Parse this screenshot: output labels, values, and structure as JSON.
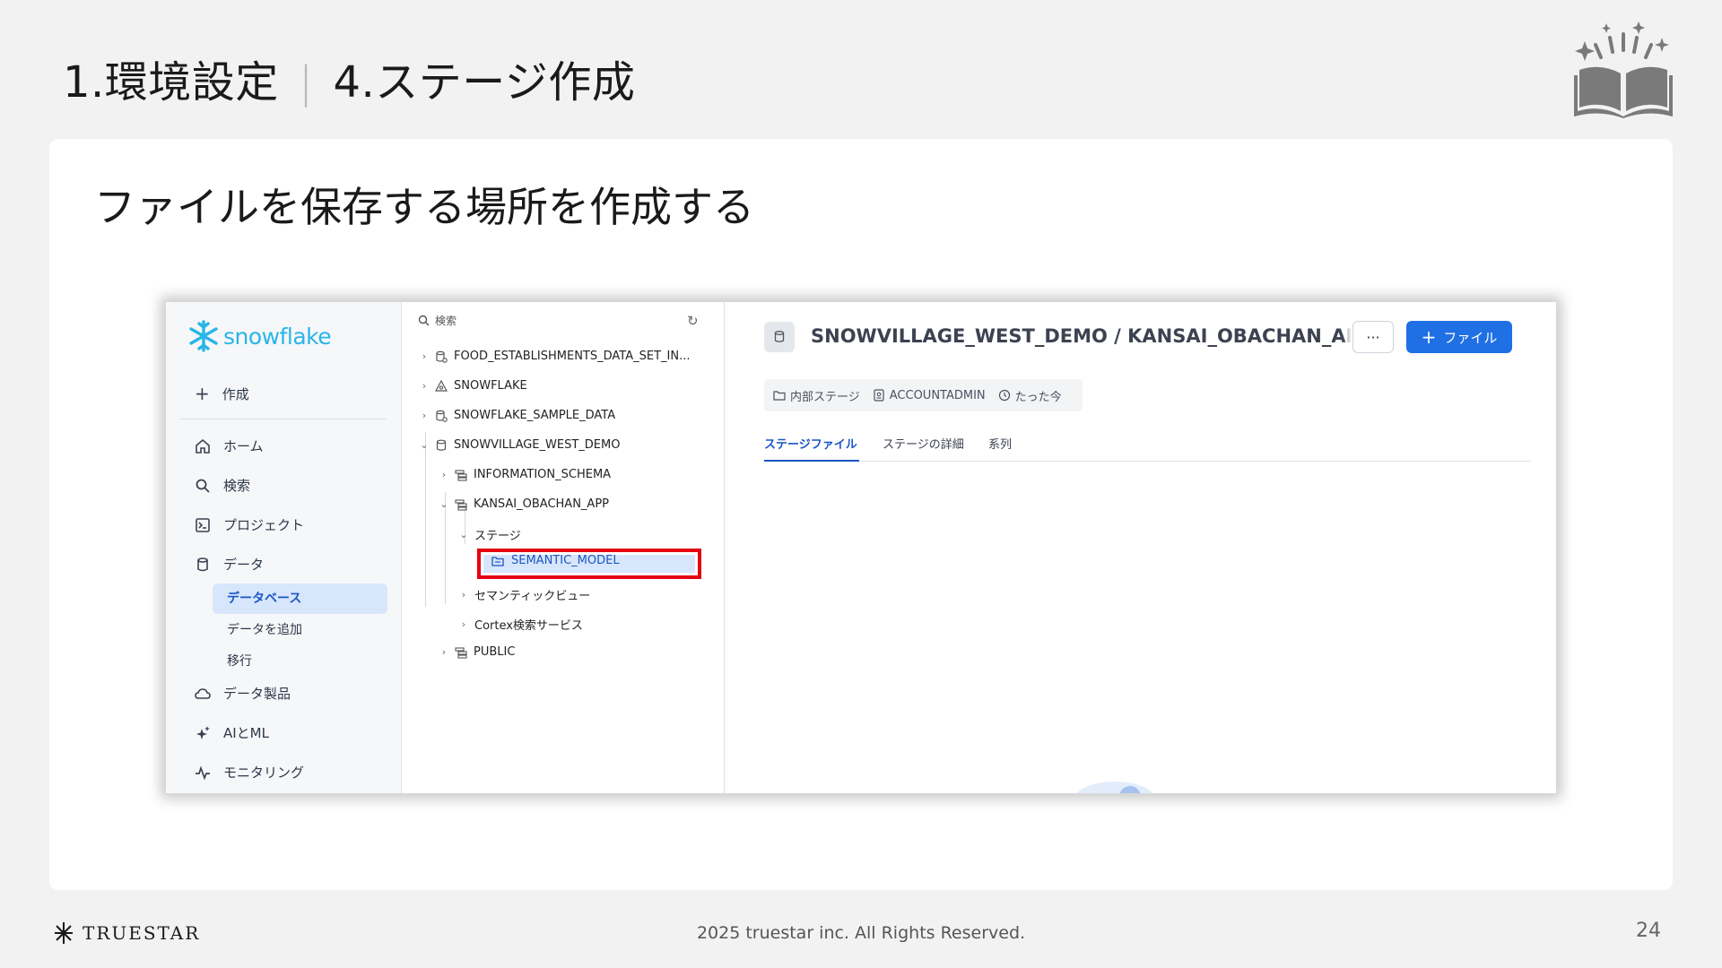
{
  "header": {
    "section_title": "1.環境設定",
    "separator": "|",
    "step_title": "4.ステージ作成"
  },
  "subtitle": "ファイルを保存する場所を作成する",
  "snowflake": {
    "logo_text": "snowflake",
    "nav": {
      "create_label": "作成",
      "items": [
        {
          "label": "ホーム",
          "icon": "home-icon"
        },
        {
          "label": "検索",
          "icon": "search-icon"
        },
        {
          "label": "プロジェクト",
          "icon": "terminal-icon"
        },
        {
          "label": "データ",
          "icon": "database-icon"
        },
        {
          "label": "データ製品",
          "icon": "cloud-icon"
        },
        {
          "label": "AIとML",
          "icon": "sparkle-icon"
        },
        {
          "label": "モニタリング",
          "icon": "activity-icon"
        }
      ],
      "data_sub_items": [
        {
          "label": "データベース",
          "active": true
        },
        {
          "label": "データを追加",
          "active": false
        },
        {
          "label": "移行",
          "active": false
        }
      ]
    },
    "tree": {
      "search_placeholder": "検索",
      "rows": [
        "FOOD_ESTABLISHMENTS_DATA_SET_IN...",
        "SNOWFLAKE",
        "SNOWFLAKE_SAMPLE_DATA",
        "SNOWVILLAGE_WEST_DEMO",
        "INFORMATION_SCHEMA",
        "KANSAI_OBACHAN_APP",
        "ステージ",
        "SEMANTIC_MODEL",
        "セマンティックビュー",
        "Cortex検索サービス",
        "PUBLIC"
      ],
      "highlight_color": "#e60012"
    },
    "main": {
      "path_title": "SNOWVILLAGE_WEST_DEMO / KANSAI_OBACHAN_APP / SEMANTIC_MODEL",
      "more_label": "···",
      "file_button_label": "ファイル",
      "meta": {
        "stage_type": "内部ステージ",
        "role": "ACCOUNTADMIN",
        "time": "たった今"
      },
      "tabs": [
        "ステージファイル",
        "ステージの詳細",
        "系列"
      ],
      "active_tab": 0,
      "accent_color": "#1f6fe5"
    }
  },
  "footer": {
    "brand": "TRUESTAR",
    "copyright": "2025 truestar inc. All Rights Reserved.",
    "page_number": "24"
  }
}
